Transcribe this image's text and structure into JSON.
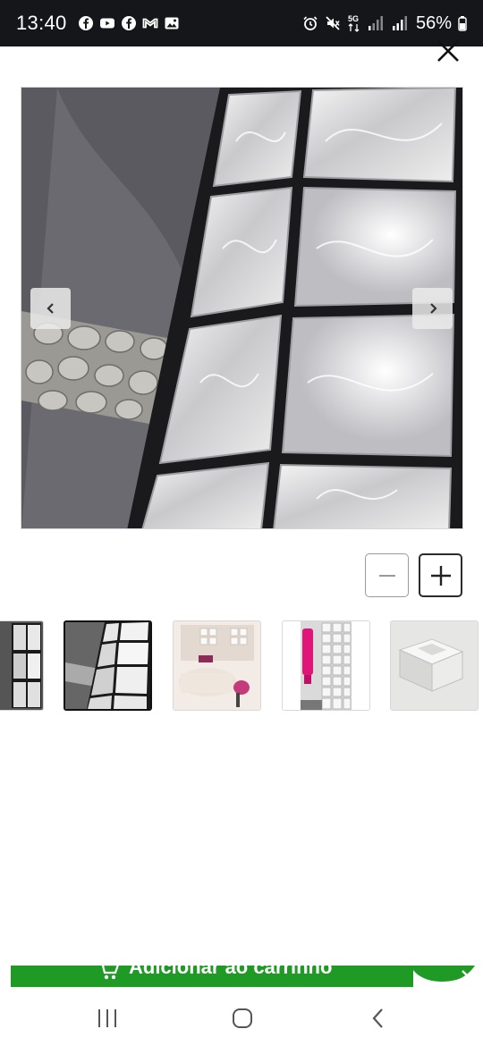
{
  "status_bar": {
    "time": "13:40",
    "battery": "56%",
    "network": "5G",
    "left_icons": [
      "facebook-icon",
      "youtube-icon",
      "facebook-icon",
      "gmail-icon",
      "gallery-icon"
    ],
    "right_icons": [
      "alarm-icon",
      "mute-icon",
      "signal-icon",
      "battery-icon"
    ]
  },
  "viewer": {
    "close_icon": "close-icon",
    "prev_icon": "chevron-left-icon",
    "next_icon": "chevron-right-icon",
    "zoom_out_icon": "minus-icon",
    "zoom_in_icon": "plus-icon",
    "main_image_subject": "glass-block-wall",
    "thumbnails": [
      {
        "subject": "glass-block-wall-partial",
        "active": false
      },
      {
        "subject": "glass-block-wall",
        "active": true
      },
      {
        "subject": "bedroom-with-glass-blocks",
        "active": false
      },
      {
        "subject": "glass-block-partition-pink-robe",
        "active": false
      },
      {
        "subject": "single-glass-block",
        "active": false
      }
    ]
  },
  "cart": {
    "label": "Adicionar ao carrinho",
    "icon": "cart-icon",
    "accent_color": "#1f9a25"
  },
  "android_nav": {
    "recents_icon": "recents-icon",
    "home_icon": "home-icon",
    "back_icon": "back-icon"
  }
}
